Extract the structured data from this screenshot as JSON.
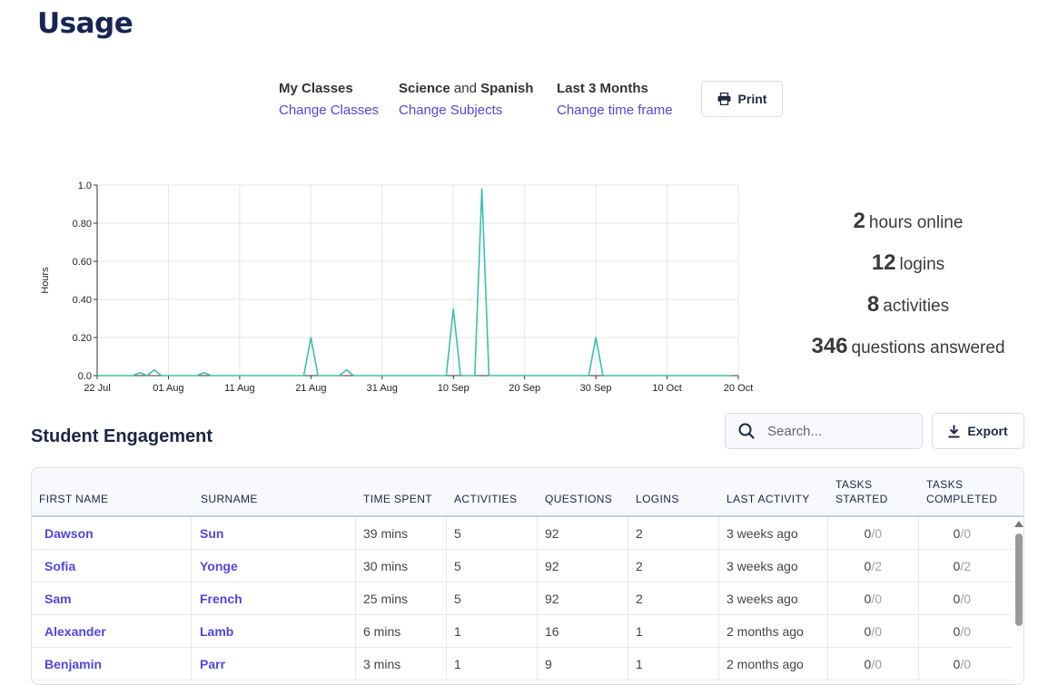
{
  "page": {
    "title": "Usage"
  },
  "filters": {
    "classes": {
      "title": "My Classes",
      "link": "Change Classes"
    },
    "subjects": {
      "subject1": "Science",
      "joiner": "and",
      "subject2": "Spanish",
      "link": "Change Subjects"
    },
    "timeframe": {
      "title": "Last 3 Months",
      "link": "Change time frame"
    },
    "print_label": "Print"
  },
  "chart_data": {
    "type": "line",
    "ylabel": "Hours",
    "xlabel": "",
    "ylim": [
      0,
      1.0
    ],
    "y_ticks": [
      "0.0",
      "0.20",
      "0.40",
      "0.60",
      "0.80",
      "1.0"
    ],
    "x_ticks": [
      "22 Jul",
      "01 Aug",
      "11 Aug",
      "21 Aug",
      "31 Aug",
      "10 Sep",
      "20 Sep",
      "30 Sep",
      "10 Oct",
      "20 Oct"
    ],
    "grid": true,
    "color": "#3dbfae",
    "series": [
      {
        "x": [
          "2023-07-22",
          "2023-07-27",
          "2023-07-28",
          "2023-07-29",
          "2023-07-30",
          "2023-07-31",
          "2023-08-01",
          "2023-08-02",
          "2023-08-05",
          "2023-08-06",
          "2023-08-07",
          "2023-08-19",
          "2023-08-20",
          "2023-08-21",
          "2023-08-22",
          "2023-08-25",
          "2023-08-26",
          "2023-08-27",
          "2023-09-08",
          "2023-09-09",
          "2023-09-10",
          "2023-09-11",
          "2023-09-12",
          "2023-09-13",
          "2023-09-14",
          "2023-09-15",
          "2023-09-16",
          "2023-09-28",
          "2023-09-29",
          "2023-09-30",
          "2023-10-01",
          "2023-10-19"
        ],
        "y": [
          0,
          0,
          0.015,
          0,
          0.03,
          0,
          0,
          0,
          0,
          0.015,
          0,
          0,
          0,
          0.2,
          0,
          0,
          0.03,
          0,
          0,
          0,
          0.35,
          0,
          0,
          0,
          0.98,
          0,
          0,
          0,
          0,
          0.2,
          0,
          0
        ]
      }
    ]
  },
  "stats": [
    {
      "value": "2",
      "label": "hours online"
    },
    {
      "value": "12",
      "label": "logins"
    },
    {
      "value": "8",
      "label": "activities"
    },
    {
      "value": "346",
      "label": "questions answered"
    }
  ],
  "engagement": {
    "title": "Student Engagement",
    "search_placeholder": "Search...",
    "export_label": "Export",
    "columns": [
      "FIRST NAME",
      "SURNAME",
      "TIME SPENT",
      "ACTIVITIES",
      "QUESTIONS",
      "LOGINS",
      "LAST ACTIVITY",
      "TASKS\nSTARTED",
      "TASKS\nCOMPLETED"
    ],
    "rows": [
      {
        "first": "Dawson",
        "surname": "Sun",
        "time": "39 mins",
        "activities": "5",
        "questions": "92",
        "logins": "2",
        "last": "3 weeks ago",
        "started_done": "0",
        "started_total": "0",
        "completed_done": "0",
        "completed_total": "0"
      },
      {
        "first": "Sofia",
        "surname": "Yonge",
        "time": "30 mins",
        "activities": "5",
        "questions": "92",
        "logins": "2",
        "last": "3 weeks ago",
        "started_done": "0",
        "started_total": "2",
        "completed_done": "0",
        "completed_total": "2"
      },
      {
        "first": "Sam",
        "surname": "French",
        "time": "25 mins",
        "activities": "5",
        "questions": "92",
        "logins": "2",
        "last": "3 weeks ago",
        "started_done": "0",
        "started_total": "0",
        "completed_done": "0",
        "completed_total": "0"
      },
      {
        "first": "Alexander",
        "surname": "Lamb",
        "time": "6 mins",
        "activities": "1",
        "questions": "16",
        "logins": "1",
        "last": "2 months ago",
        "started_done": "0",
        "started_total": "0",
        "completed_done": "0",
        "completed_total": "0"
      },
      {
        "first": "Benjamin",
        "surname": "Parr",
        "time": "3 mins",
        "activities": "1",
        "questions": "9",
        "logins": "1",
        "last": "2 months ago",
        "started_done": "0",
        "started_total": "0",
        "completed_done": "0",
        "completed_total": "0"
      }
    ]
  }
}
